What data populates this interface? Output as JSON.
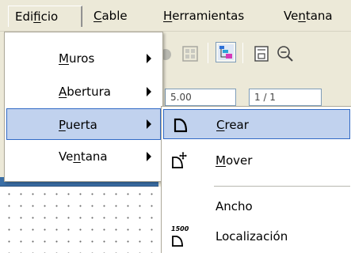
{
  "menubar": {
    "items": [
      {
        "label_pre": "Edi",
        "label_u": "f",
        "label_post": "icio"
      },
      {
        "label_pre": "",
        "label_u": "C",
        "label_post": "able"
      },
      {
        "label_pre": "",
        "label_u": "H",
        "label_post": "erramientas"
      },
      {
        "label_pre": "Ve",
        "label_u": "n",
        "label_post": "tana"
      }
    ]
  },
  "toolbar": {
    "fields": [
      "5.00",
      "1 / 1"
    ]
  },
  "edificio_menu": {
    "items": [
      {
        "label_pre": "",
        "label_u": "M",
        "label_post": "uros"
      },
      {
        "label_pre": "",
        "label_u": "A",
        "label_post": "bertura"
      },
      {
        "label_pre": "",
        "label_u": "P",
        "label_post": "uerta"
      },
      {
        "label_pre": "Ve",
        "label_u": "n",
        "label_post": "tana"
      }
    ],
    "highlighted_index": 2
  },
  "puerta_submenu": {
    "items": [
      {
        "label_pre": "",
        "label_u": "C",
        "label_post": "rear",
        "icon": "door-create-icon"
      },
      {
        "label_pre": "",
        "label_u": "M",
        "label_post": "over",
        "icon": "door-move-icon"
      },
      {
        "label_pre": "Ancho",
        "label_u": "",
        "label_post": "",
        "icon": ""
      },
      {
        "label_pre": "Localización",
        "label_u": "",
        "label_post": "",
        "icon": "door-location-icon",
        "icon_text": "1500"
      }
    ],
    "highlighted_index": 0
  },
  "colors": {
    "highlight_fill": "#c1d2ee",
    "highlight_border": "#316ac5",
    "menubar_bg": "#ece9d8"
  }
}
